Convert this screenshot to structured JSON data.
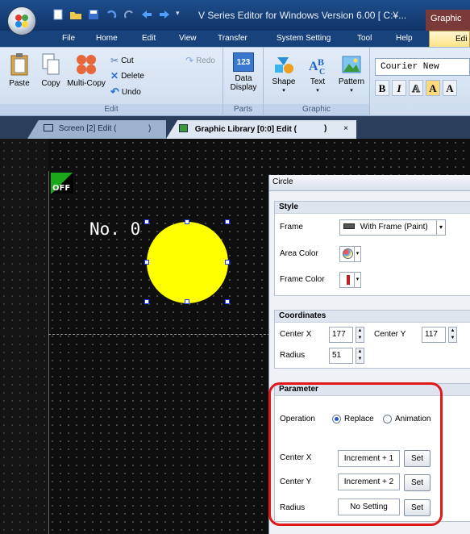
{
  "window": {
    "title": "V Series Editor for Windows Version 6.00 [ C:¥...",
    "context_tab": "Graphic"
  },
  "ribbon_tabs": [
    "File",
    "Home",
    "Edit",
    "View",
    "Transfer",
    "System Setting",
    "Tool",
    "Help"
  ],
  "active_tab": "Edi",
  "ribbon": {
    "edit_group": {
      "label": "Edit",
      "paste": "Paste",
      "copy": "Copy",
      "multi_copy": "Multi-Copy",
      "cut": "Cut",
      "delete": "Delete",
      "undo": "Undo",
      "redo": "Redo"
    },
    "parts_group": {
      "label": "Parts",
      "data_display": "Data Display",
      "data_display_line1": "Data",
      "data_display_line2": "Display",
      "icon_text": "123"
    },
    "graphic_group": {
      "label": "Graphic",
      "shape": "Shape",
      "text": "Text",
      "pattern": "Pattern"
    },
    "font": {
      "name": "Courier New",
      "styles": [
        "B",
        "I",
        "A",
        "A",
        "A"
      ]
    }
  },
  "doc_tabs": [
    {
      "label": "Screen [2] Edit (",
      "suffix": ")"
    },
    {
      "label": "Graphic Library [0:0] Edit (",
      "suffix": ")",
      "close": "×"
    }
  ],
  "canvas": {
    "off_tag": "OFF",
    "object_label": "No. 0",
    "circle_color": "#ffff00"
  },
  "panel": {
    "title": "Circle",
    "style": {
      "heading": "Style",
      "frame_label": "Frame",
      "frame_value": "With Frame (Paint)",
      "area_color_label": "Area Color",
      "frame_color_label": "Frame Color"
    },
    "coordinates": {
      "heading": "Coordinates",
      "center_x_label": "Center X",
      "center_x_value": "177",
      "center_y_label": "Center Y",
      "center_y_value": "117",
      "radius_label": "Radius",
      "radius_value": "51"
    },
    "parameter": {
      "heading": "Parameter",
      "operation_label": "Operation",
      "replace": "Replace",
      "animation": "Animation",
      "selected_operation": "Replace",
      "center_x_label": "Center X",
      "center_x_value": "Increment + 1",
      "center_y_label": "Center Y",
      "center_y_value": "Increment + 2",
      "radius_label": "Radius",
      "radius_value": "No Setting",
      "set_label": "Set"
    }
  },
  "colors": {
    "titlebar": "#1e4e8c",
    "canvas_bg": "#0e0e0e",
    "highlight": "#e01818",
    "off_green": "#1aa81a"
  }
}
